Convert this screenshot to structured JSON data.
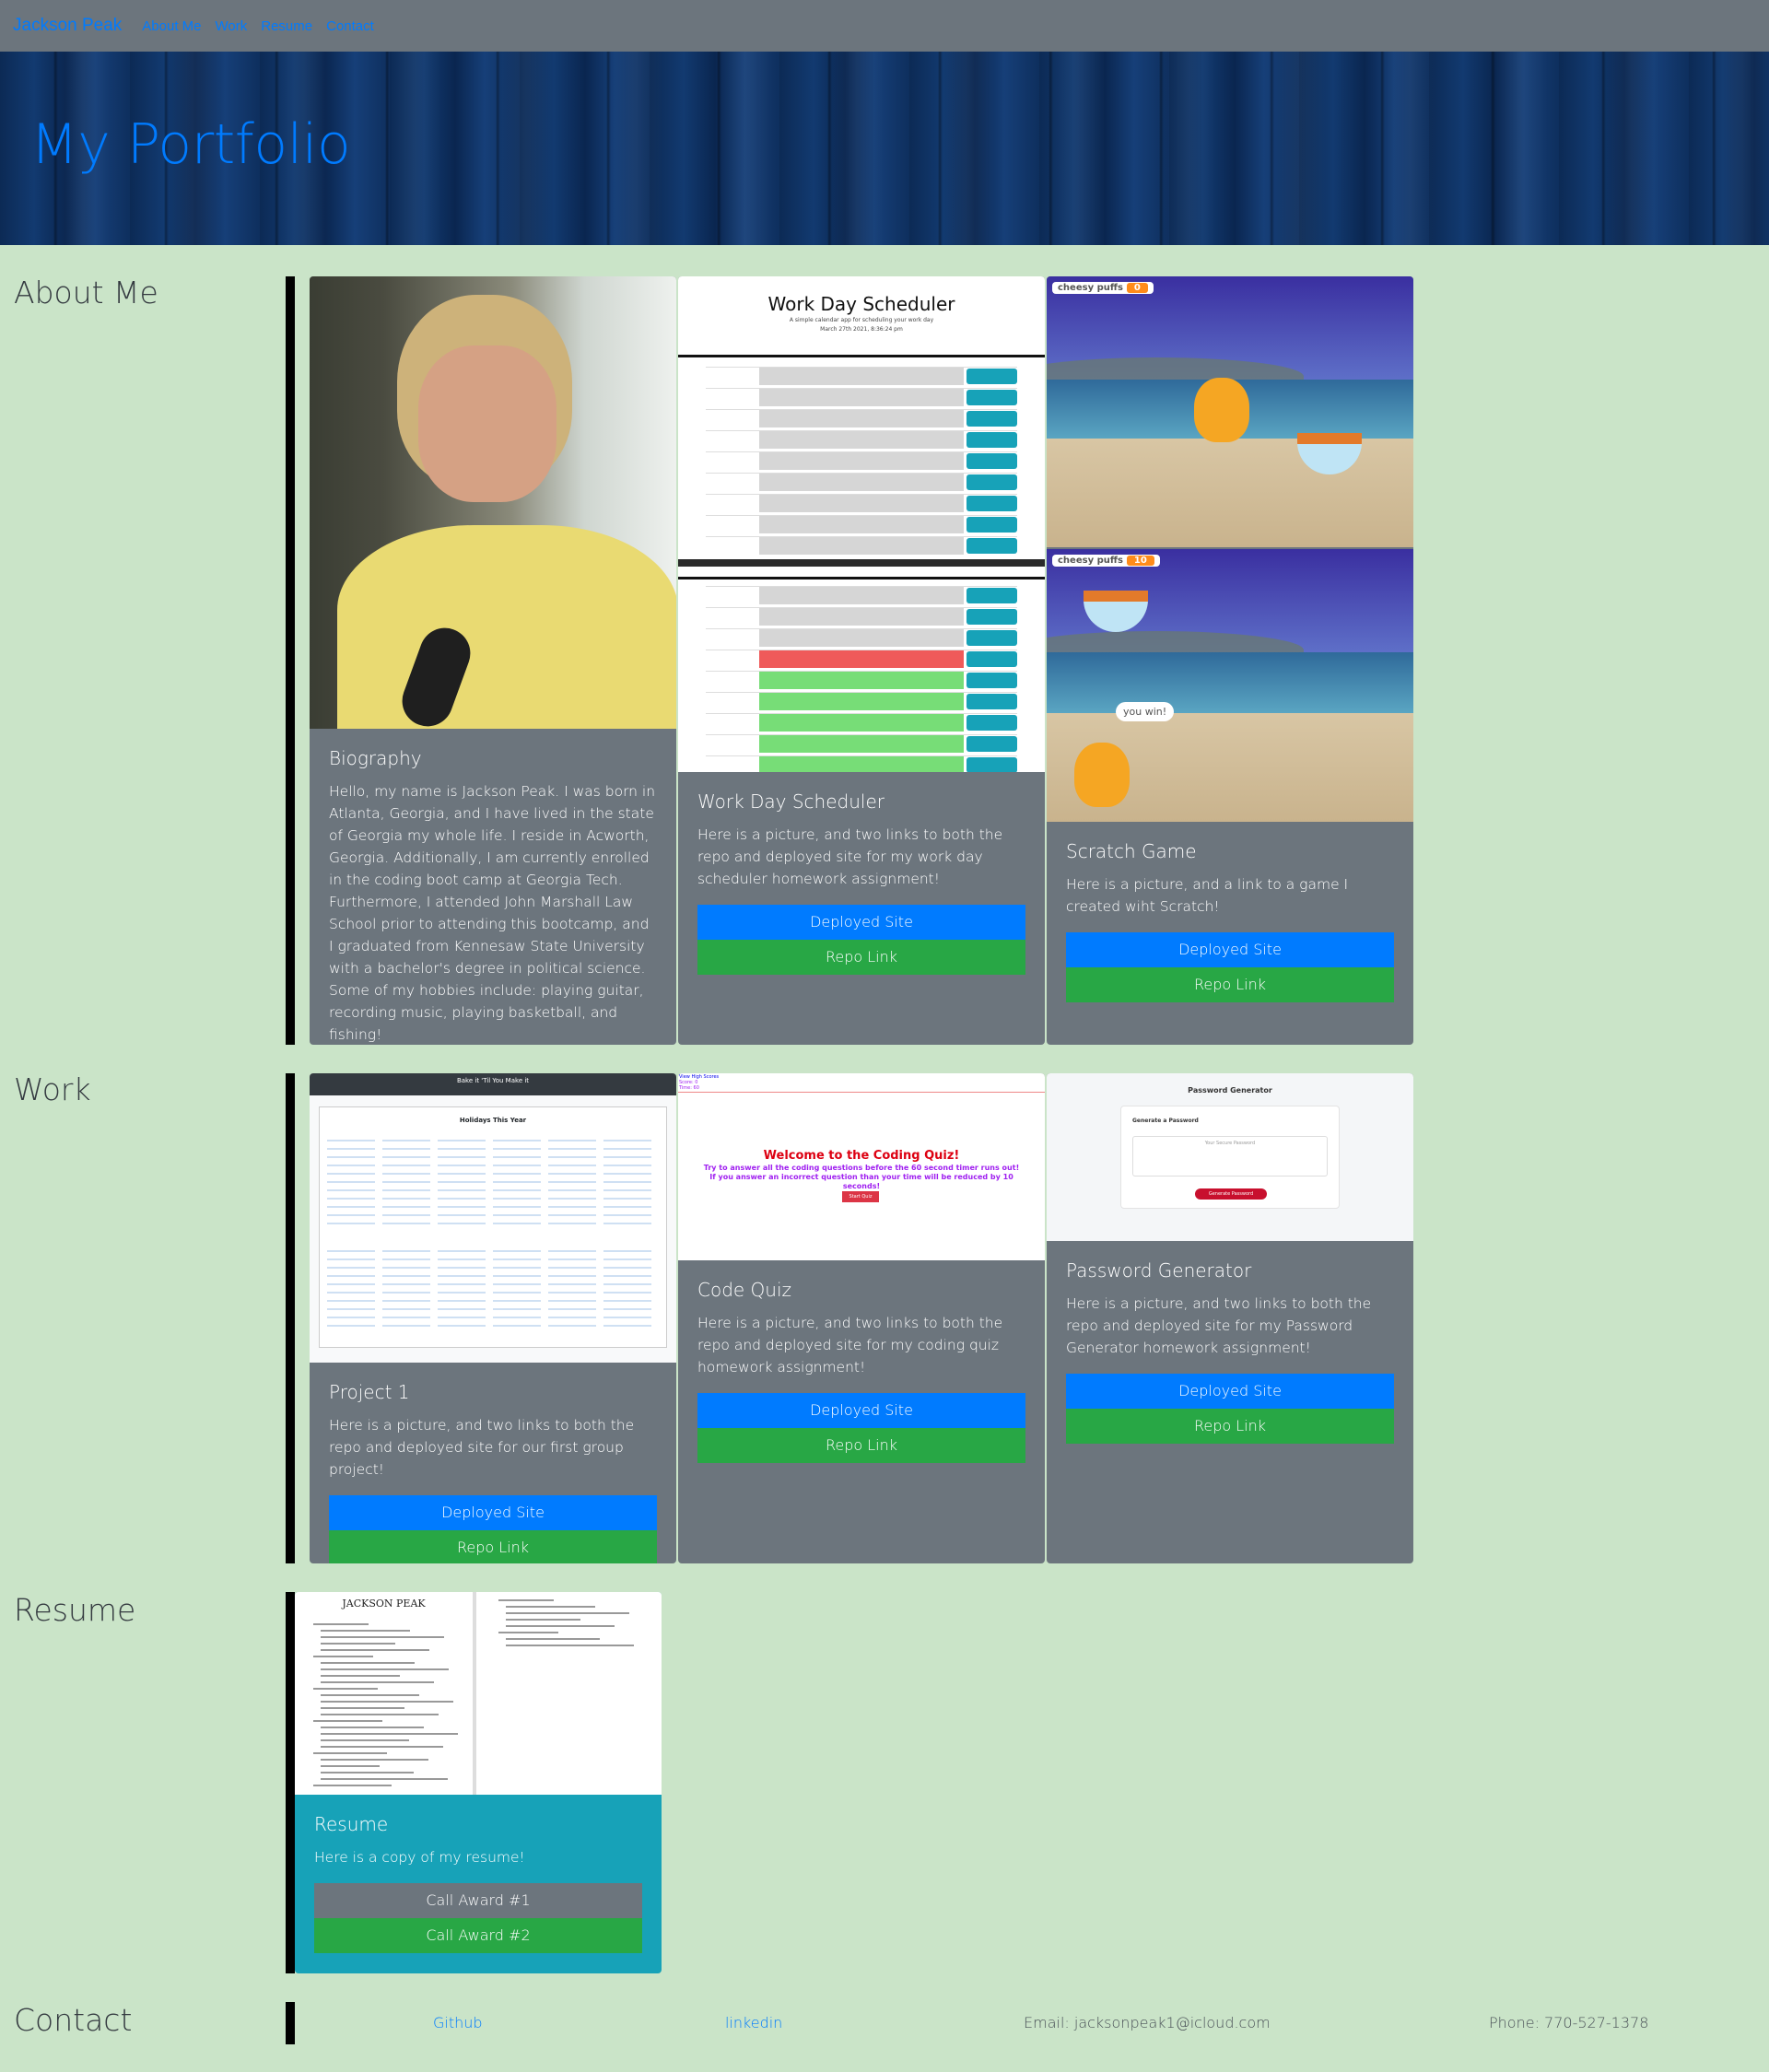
{
  "nav": {
    "brand": "Jackson Peak",
    "links": [
      "About Me",
      "Work",
      "Resume",
      "Contact"
    ]
  },
  "hero": {
    "title": "My Portfolio"
  },
  "sections": {
    "about": "About Me",
    "work": "Work",
    "resume": "Resume",
    "contact": "Contact"
  },
  "about_cards": {
    "bio": {
      "title": "Biography",
      "text": "Hello, my name is Jackson Peak. I was born in Atlanta, Georgia, and I have lived in the state of Georgia my whole life. I reside in Acworth, Georgia. Additionally, I am currently enrolled in the coding boot camp at Georgia Tech. Furthermore, I attended John Marshall Law School prior to attending this bootcamp, and I graduated from Kennesaw State University with a bachelor's degree in political science. Some of my hobbies include: playing guitar, recording music, playing basketball, and fishing!"
    },
    "scheduler": {
      "title": "Work Day Scheduler",
      "text": "Here is a picture, and two links to both the repo and deployed site for my work day scheduler homework assignment!",
      "deployed": "Deployed Site",
      "repo": "Repo Link",
      "img_title": "Work Day Scheduler",
      "img_sub": "A simple calendar app for scheduling your work day",
      "img_date": "March 27th 2021, 8:36:24 pm"
    },
    "scratch": {
      "title": "Scratch Game",
      "text": "Here is a picture, and a link to a game I created wiht Scratch!",
      "deployed": "Deployed Site",
      "repo": "Repo Link",
      "score_label": "cheesy puffs",
      "score1": "0",
      "score2": "10",
      "bubble": "you win!"
    }
  },
  "work_cards": {
    "project1": {
      "title": "Project 1",
      "text": "Here is a picture, and two links to both the repo and deployed site for our first group project!",
      "deployed": "Deployed Site",
      "repo": "Repo Link",
      "img_title": "Bake it 'Til You Make it",
      "img_heading": "Holidays This Year"
    },
    "quiz": {
      "title": "Code Quiz",
      "text": "Here is a picture, and two links to both the repo and deployed site for my coding quiz homework assignment!",
      "deployed": "Deployed Site",
      "repo": "Repo Link",
      "img_heading": "Welcome to the Coding Quiz!",
      "img_text": "Try to answer all the coding questions before the 60 second timer runs out! If you answer an incorrect question than your time will be reduced by 10 seconds!",
      "img_links": [
        "View High Scores",
        "Score: 0",
        "Time: 60"
      ],
      "img_button": "Start Quiz"
    },
    "password": {
      "title": "Password Generator",
      "text": "Here is a picture, and two links to both the repo and deployed site for my Password Generator homework assignment!",
      "deployed": "Deployed Site",
      "repo": "Repo Link",
      "img_title": "Password Generator",
      "img_sub": "Generate a Password",
      "img_placeholder": "Your Secure Password",
      "img_button": "Generate Password"
    }
  },
  "resume_card": {
    "title": "Resume",
    "text": "Here is a copy of my resume!",
    "award1": "Call Award #1",
    "award2": "Call Award #2",
    "img_name": "JACKSON PEAK"
  },
  "contact": {
    "github": "Github",
    "linkedin": "linkedin",
    "email": "Email: jacksonpeak1@icloud.com",
    "phone": "Phone: 770-527-1378"
  },
  "colors": {
    "background": "#cae4c8",
    "card": "#6c757d",
    "primary": "#007bff",
    "success": "#28a745",
    "info": "#17a2b8"
  }
}
